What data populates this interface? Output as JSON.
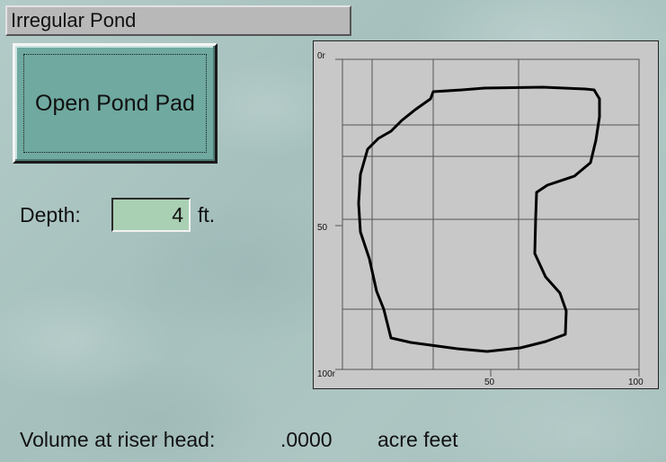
{
  "window": {
    "title": "Irregular Pond"
  },
  "actions": {
    "open_pond_pad_label": "Open Pond Pad"
  },
  "depth": {
    "label": "Depth:",
    "value": "4",
    "unit": "ft."
  },
  "volume": {
    "label": "Volume at riser head:",
    "value": ".0000",
    "unit": "acre feet"
  },
  "plot": {
    "y_tick_labels": [
      "0r",
      "50",
      "100r"
    ],
    "x_tick_labels": [
      "50",
      "100"
    ],
    "grid": true,
    "outline_shape": "closed irregular pond boundary",
    "colors": {
      "background": "#c8c8c8",
      "grid": "#555555",
      "outline": "#000000"
    }
  }
}
